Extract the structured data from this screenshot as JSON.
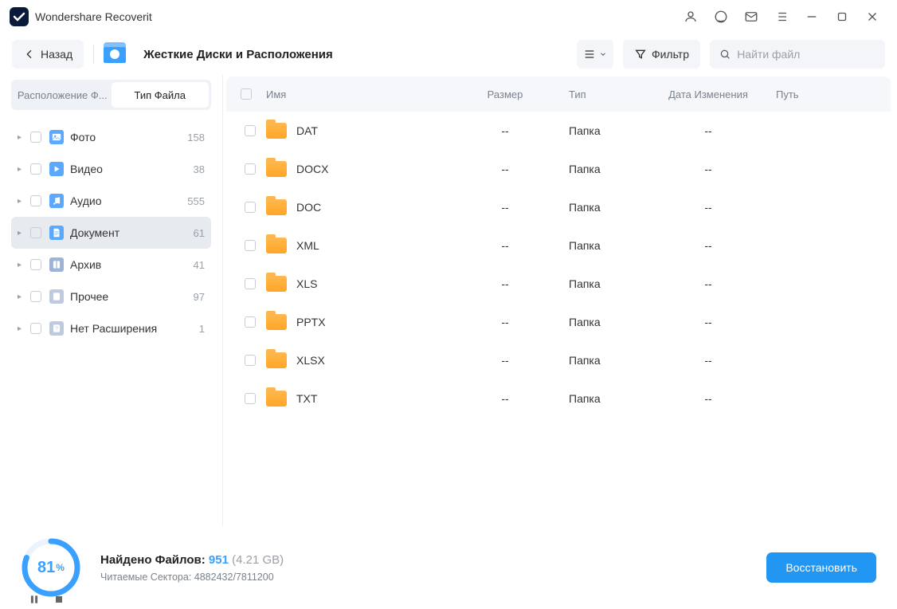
{
  "app": {
    "title": "Wondershare Recoverit"
  },
  "toolbar": {
    "back": "Назад",
    "location": "Жесткие Диски и Расположения",
    "filter": "Фильтр",
    "search_placeholder": "Найти файл"
  },
  "sidebar": {
    "tab_location": "Расположение Ф...",
    "tab_filetype": "Тип Файла",
    "items": [
      {
        "label": "Фото",
        "count": "158",
        "icon": "ic-photo"
      },
      {
        "label": "Видео",
        "count": "38",
        "icon": "ic-video"
      },
      {
        "label": "Аудио",
        "count": "555",
        "icon": "ic-audio"
      },
      {
        "label": "Документ",
        "count": "61",
        "icon": "ic-doc",
        "selected": true
      },
      {
        "label": "Архив",
        "count": "41",
        "icon": "ic-arch"
      },
      {
        "label": "Прочее",
        "count": "97",
        "icon": "ic-other"
      },
      {
        "label": "Нет Расширения",
        "count": "1",
        "icon": "ic-noext"
      }
    ]
  },
  "table": {
    "headers": {
      "name": "Имя",
      "size": "Размер",
      "type": "Тип",
      "date": "Дата Изменения",
      "path": "Путь"
    },
    "rows": [
      {
        "name": "DAT",
        "size": "--",
        "type": "Папка",
        "date": "--"
      },
      {
        "name": "DOCX",
        "size": "--",
        "type": "Папка",
        "date": "--"
      },
      {
        "name": "DOC",
        "size": "--",
        "type": "Папка",
        "date": "--"
      },
      {
        "name": "XML",
        "size": "--",
        "type": "Папка",
        "date": "--"
      },
      {
        "name": "XLS",
        "size": "--",
        "type": "Папка",
        "date": "--"
      },
      {
        "name": "PPTX",
        "size": "--",
        "type": "Папка",
        "date": "--"
      },
      {
        "name": "XLSX",
        "size": "--",
        "type": "Папка",
        "date": "--"
      },
      {
        "name": "TXT",
        "size": "--",
        "type": "Папка",
        "date": "--"
      }
    ]
  },
  "status": {
    "percent": "81",
    "percent_suffix": "%",
    "found_label": "Найдено Файлов: ",
    "found_count": "951",
    "found_size": "(4.21 GB)",
    "sectors_label": "Читаемые Сектора: ",
    "sectors_value": "4882432/7811200",
    "recover": "Восстановить"
  }
}
